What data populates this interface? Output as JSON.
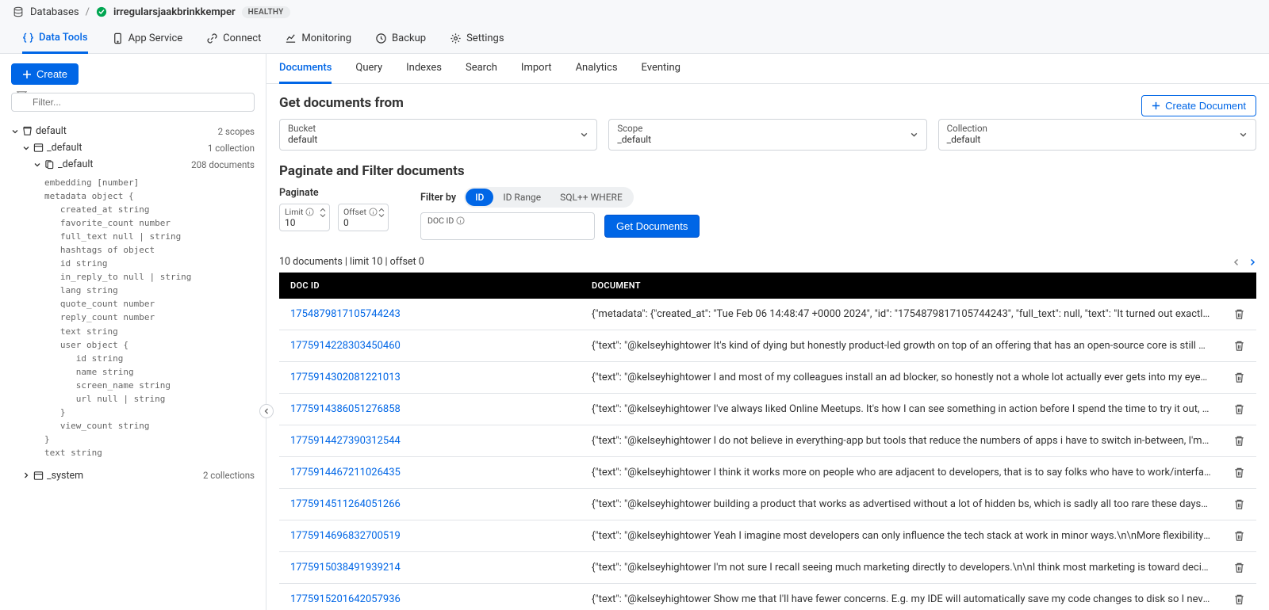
{
  "breadcrumb": {
    "root": "Databases",
    "db_name": "irregularsjaakbrinkkemper",
    "health": "HEALTHY"
  },
  "primary_tabs": {
    "data_tools": "Data Tools",
    "app_service": "App Service",
    "connect": "Connect",
    "monitoring": "Monitoring",
    "backup": "Backup",
    "settings": "Settings"
  },
  "sidebar": {
    "create": "Create",
    "filter_placeholder": "Filter...",
    "tree": {
      "bucket": {
        "name": "default",
        "meta": "2 scopes"
      },
      "scope": {
        "name": "_default",
        "meta": "1 collection"
      },
      "collection": {
        "name": "_default",
        "meta": "208 documents"
      },
      "system": {
        "name": "_system",
        "meta": "2 collections"
      }
    },
    "schema": "embedding [number]\nmetadata object {\n   created_at string\n   favorite_count number\n   full_text null | string\n   hashtags of object\n   id string\n   in_reply_to null | string\n   lang string\n   quote_count number\n   reply_count number\n   text string\n   user object {\n      id string\n      name string\n      screen_name string\n      url null | string\n   }\n   view_count string\n}\ntext string"
  },
  "secondary_tabs": [
    "Documents",
    "Query",
    "Indexes",
    "Search",
    "Import",
    "Analytics",
    "Eventing"
  ],
  "getfrom": {
    "title": "Get documents from",
    "create_doc": "Create Document",
    "bucket": {
      "label": "Bucket",
      "value": "default"
    },
    "scope": {
      "label": "Scope",
      "value": "_default"
    },
    "collection": {
      "label": "Collection",
      "value": "_default"
    }
  },
  "paginate": {
    "title": "Paginate and Filter documents",
    "paginate_label": "Paginate",
    "filter_label": "Filter by",
    "limit": {
      "label": "Limit",
      "value": "10"
    },
    "offset": {
      "label": "Offset",
      "value": "0"
    },
    "pills": {
      "id": "ID",
      "range": "ID Range",
      "sql": "SQL++ WHERE"
    },
    "docid_label": "DOC ID",
    "get_btn": "Get Documents"
  },
  "status": "10 documents | limit 10 | offset 0",
  "table": {
    "col_id": "DOC ID",
    "col_doc": "DOCUMENT",
    "rows": [
      {
        "id": "1754879817105744243",
        "doc": "{\"metadata\": {\"created_at\": \"Tue Feb 06 14:48:47 +0000 2024\", \"id\": \"1754879817105744243\", \"full_text\": null, \"text\": \"It turned out exactly how yo..."
      },
      {
        "id": "1775914228303450460",
        "doc": "{\"text\": \"@kelseyhightower It's kind of dying but honestly product-led growth on top of an offering that has an open-source core is still what I lo..."
      },
      {
        "id": "1775914302081221013",
        "doc": "{\"text\": \"@kelseyhightower I and most of my colleagues install an ad blocker, so honestly not a whole lot actually ever gets into my eyesight.\\n\\n..."
      },
      {
        "id": "1775914386051276858",
        "doc": "{\"text\": \"@kelseyhightower I've always liked Online Meetups. It's how I can see something in action before I spend the time to try it out, though I ..."
      },
      {
        "id": "1775914427390312544",
        "doc": "{\"text\": \"@kelseyhightower I do not believe in everything-app but tools that reduce the numbers of apps i have to switch in-between, I'm very m..."
      },
      {
        "id": "1775914467211026435",
        "doc": "{\"text\": \"@kelseyhightower I think it works more on people who are adjacent to developers, that is to say folks who have to work/interface with d..."
      },
      {
        "id": "1775914511264051266",
        "doc": "{\"text\": \"@kelseyhightower building a product that works as advertised without a lot of hidden bs, which is sadly all too rare these days\", \"embed..."
      },
      {
        "id": "1775914696832700519",
        "doc": "{\"text\": \"@kelseyhightower Yeah I imagine most developers can only influence the tech stack at work in minor ways.\\n\\nMore flexibility in startup..."
      },
      {
        "id": "1775915038491939214",
        "doc": "{\"text\": \"@kelseyhightower I'm not sure I recall seeing much marketing directly to developers.\\n\\nI think most marketing is toward decision make..."
      },
      {
        "id": "1775915201642057936",
        "doc": "{\"text\": \"@kelseyhightower Show me that I'll have fewer concerns. E.g. my IDE will automatically save my code changes to disk so I never worry a..."
      }
    ]
  }
}
